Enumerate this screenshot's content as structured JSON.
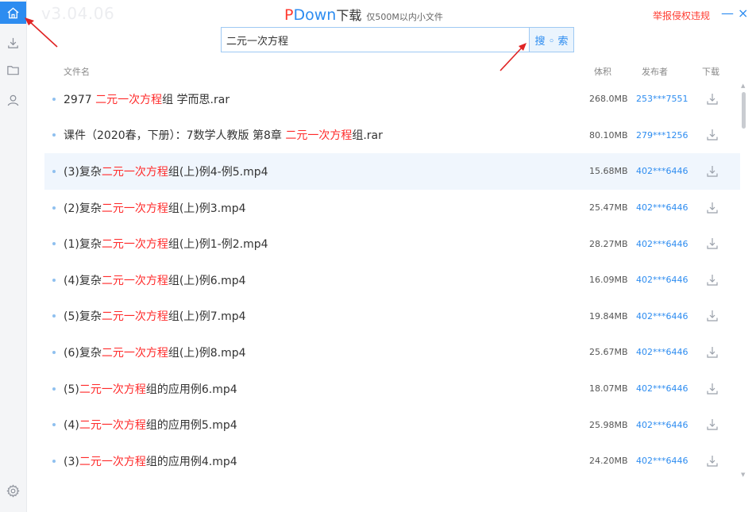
{
  "app": {
    "version": "v3.04.06",
    "brand_p": "P",
    "brand_rest": "Down",
    "brand_title": "下载",
    "brand_sub": "仅500M以内小文件",
    "report_link": "举报侵权违规",
    "minimize": "—",
    "close": "×"
  },
  "sidebar": {
    "items": [
      {
        "icon": "home-icon",
        "active": true
      },
      {
        "icon": "download-icon",
        "active": false
      },
      {
        "icon": "folder-icon",
        "active": false
      },
      {
        "icon": "user-icon",
        "active": false
      }
    ],
    "settings_icon": "gear-icon"
  },
  "search": {
    "value": "二元一次方程",
    "button_label": "搜 ◦ 索"
  },
  "table": {
    "headers": {
      "name": "文件名",
      "size": "体积",
      "publisher": "发布者",
      "download": "下载"
    },
    "rows": [
      {
        "pre": "2977 ",
        "kw": "二元一次方程",
        "post": "组 学而思.rar",
        "size": "268.0MB",
        "publisher": "253***7551",
        "highlight": false
      },
      {
        "pre": "课件（2020春，下册）：7数学人教版 第8章  ",
        "kw": "二元一次方程",
        "post": "组.rar",
        "size": "80.10MB",
        "publisher": "279***1256",
        "highlight": false
      },
      {
        "pre": "(3)复杂",
        "kw": "二元一次方程",
        "post": "组(上)例4-例5.mp4",
        "size": "15.68MB",
        "publisher": "402***6446",
        "highlight": true
      },
      {
        "pre": "(2)复杂",
        "kw": "二元一次方程",
        "post": "组(上)例3.mp4",
        "size": "25.47MB",
        "publisher": "402***6446",
        "highlight": false
      },
      {
        "pre": "(1)复杂",
        "kw": "二元一次方程",
        "post": "组(上)例1-例2.mp4",
        "size": "28.27MB",
        "publisher": "402***6446",
        "highlight": false
      },
      {
        "pre": "(4)复杂",
        "kw": "二元一次方程",
        "post": "组(上)例6.mp4",
        "size": "16.09MB",
        "publisher": "402***6446",
        "highlight": false
      },
      {
        "pre": "(5)复杂",
        "kw": "二元一次方程",
        "post": "组(上)例7.mp4",
        "size": "19.84MB",
        "publisher": "402***6446",
        "highlight": false
      },
      {
        "pre": "(6)复杂",
        "kw": "二元一次方程",
        "post": "组(上)例8.mp4",
        "size": "25.67MB",
        "publisher": "402***6446",
        "highlight": false
      },
      {
        "pre": "(5)",
        "kw": "二元一次方程",
        "post": "组的应用例6.mp4",
        "size": "18.07MB",
        "publisher": "402***6446",
        "highlight": false
      },
      {
        "pre": "(4)",
        "kw": "二元一次方程",
        "post": "组的应用例5.mp4",
        "size": "25.98MB",
        "publisher": "402***6446",
        "highlight": false
      },
      {
        "pre": "(3)",
        "kw": "二元一次方程",
        "post": "组的应用例4.mp4",
        "size": "24.20MB",
        "publisher": "402***6446",
        "highlight": false
      }
    ]
  },
  "colors": {
    "accent": "#2d8cf0",
    "keyword": "#ff2a2a",
    "annotation_arrow": "#e02424"
  }
}
